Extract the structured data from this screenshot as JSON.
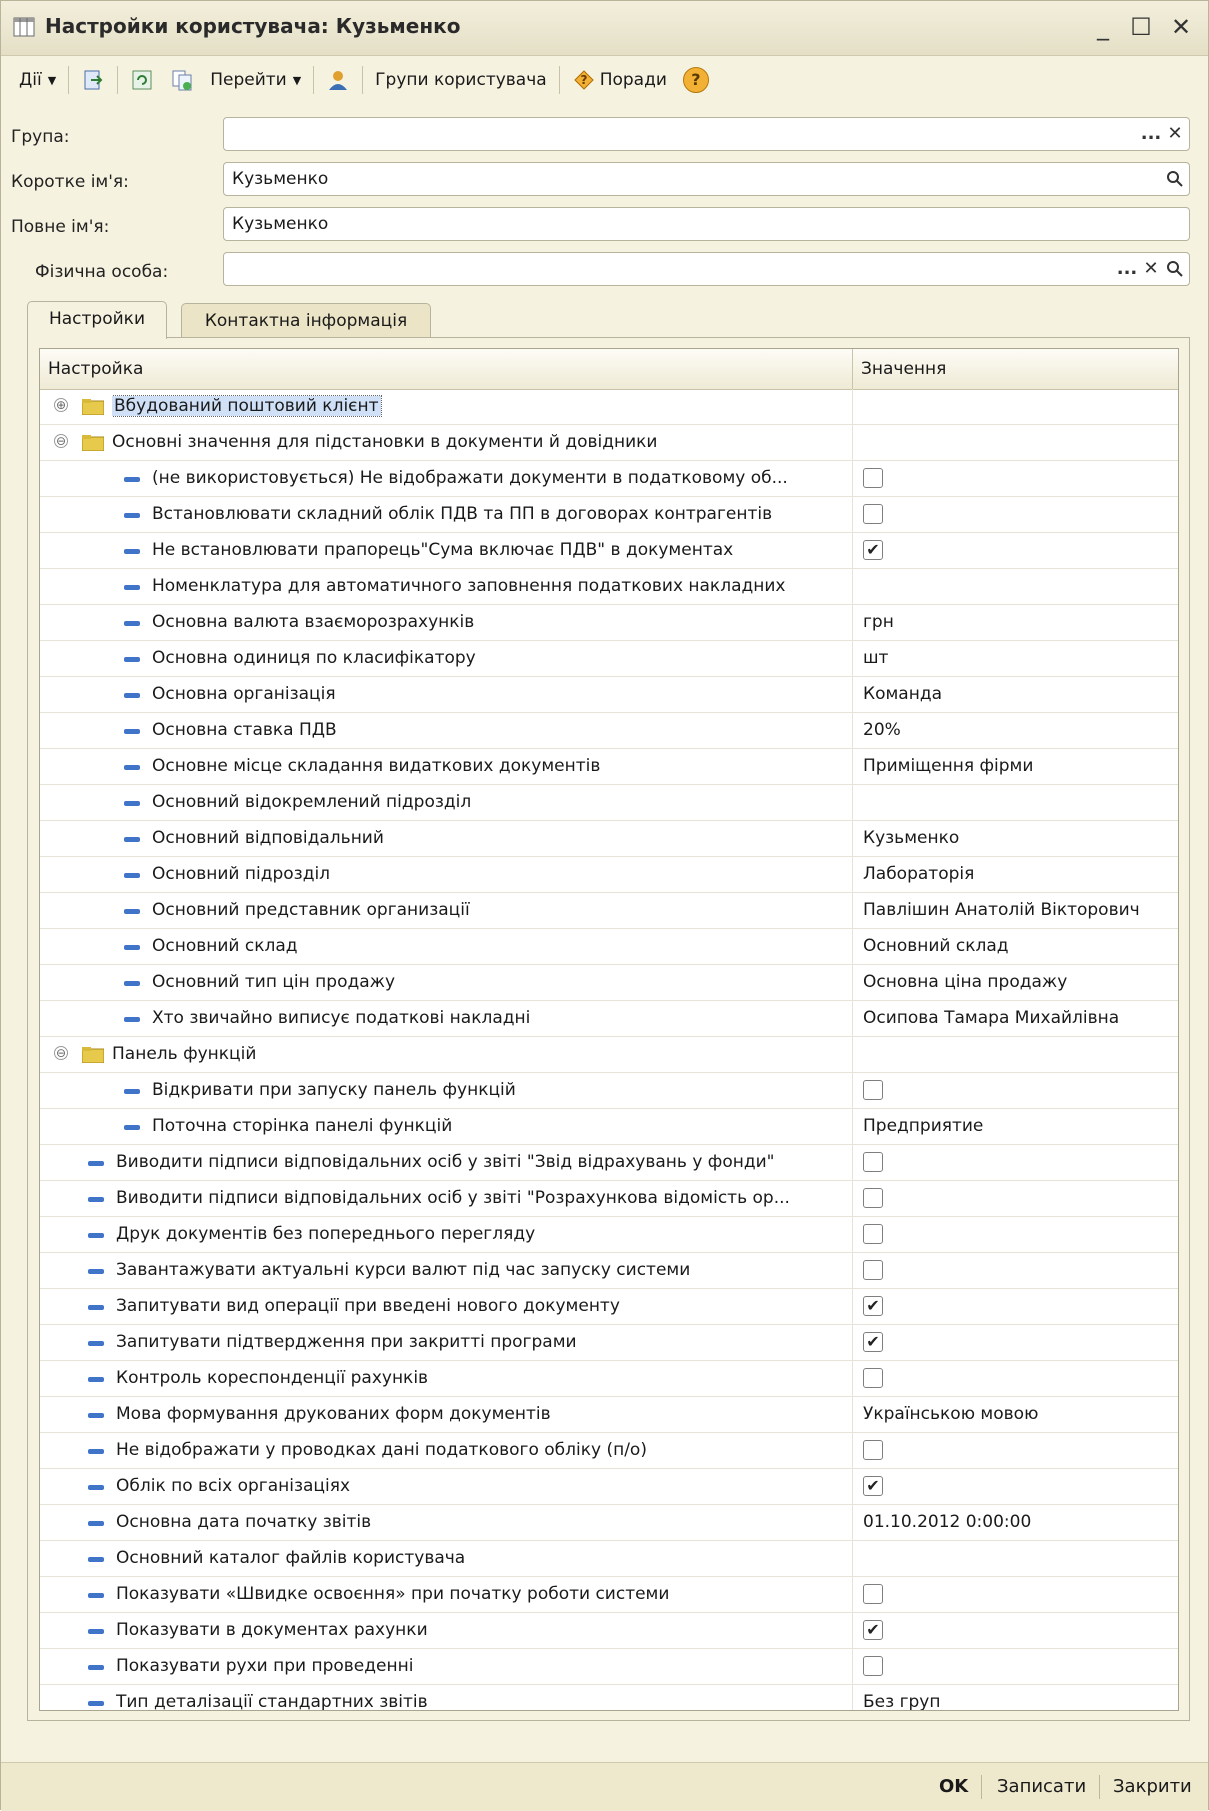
{
  "window": {
    "title": "Настройки користувача: Кузьменко",
    "minimize": "_",
    "maximize": "☐",
    "close": "✕"
  },
  "toolbar": {
    "actions_label": "Дії",
    "goto_label": "Перейти",
    "user_groups_label": "Групи користувача",
    "tips_label": "Поради",
    "help_icon_glyph": "?"
  },
  "form": {
    "group_label": "Група:",
    "group_value": "",
    "short_name_label": "Коротке ім'я:",
    "short_name_value": "Кузьменко",
    "full_name_label": "Повне ім'я:",
    "full_name_value": "Кузьменко",
    "person_label": "Фізична особа:",
    "person_value": "",
    "ellipsis": "...",
    "clear": "✕"
  },
  "tabs": [
    {
      "label": "Настройки",
      "active": true
    },
    {
      "label": "Контактна інформація",
      "active": false
    }
  ],
  "grid": {
    "col_setting": "Настройка",
    "col_value": "Значення",
    "rows": [
      {
        "level": 0,
        "type": "group",
        "expander": "⊕",
        "name": "Вбудований поштовий клієнт",
        "value": "",
        "selected": true
      },
      {
        "level": 0,
        "type": "group",
        "expander": "⊖",
        "name": "Основні значення для підстановки в документи й довідники",
        "value": ""
      },
      {
        "level": 1,
        "type": "item",
        "name": "(не використовується) Не відображати документи в податковому об...",
        "check": false
      },
      {
        "level": 1,
        "type": "item",
        "name": "Встановлювати складний облік ПДВ та ПП в договорах контрагентів",
        "check": false
      },
      {
        "level": 1,
        "type": "item",
        "name": "Не встановлювати прапорець\"Сума включає ПДВ\" в документах",
        "check": true
      },
      {
        "level": 1,
        "type": "item",
        "name": "Номенклатура для автоматичного заповнення податкових накладних",
        "value": ""
      },
      {
        "level": 1,
        "type": "item",
        "name": "Основна валюта взаєморозрахунків",
        "value": "грн"
      },
      {
        "level": 1,
        "type": "item",
        "name": "Основна одиниця по класифікатору",
        "value": "шт"
      },
      {
        "level": 1,
        "type": "item",
        "name": "Основна організація",
        "value": "Команда"
      },
      {
        "level": 1,
        "type": "item",
        "name": "Основна ставка ПДВ",
        "value": "20%"
      },
      {
        "level": 1,
        "type": "item",
        "name": "Основне місце складання видаткових документів",
        "value": "Приміщення фірми"
      },
      {
        "level": 1,
        "type": "item",
        "name": "Основний відокремлений підрозділ",
        "value": ""
      },
      {
        "level": 1,
        "type": "item",
        "name": "Основний відповідальний",
        "value": "Кузьменко"
      },
      {
        "level": 1,
        "type": "item",
        "name": "Основний підрозділ",
        "value": "Лабораторія"
      },
      {
        "level": 1,
        "type": "item",
        "name": "Основний представник организації",
        "value": "Павлішин Анатолій Вікторович"
      },
      {
        "level": 1,
        "type": "item",
        "name": "Основний склад",
        "value": "Основний склад"
      },
      {
        "level": 1,
        "type": "item",
        "name": "Основний тип цін продажу",
        "value": "Основна ціна продажу"
      },
      {
        "level": 1,
        "type": "item",
        "name": "Хто звичайно виписує податкові накладні",
        "value": "Осипова Тамара Михайлівна"
      },
      {
        "level": 0,
        "type": "group",
        "expander": "⊖",
        "name": "Панель функцій",
        "value": ""
      },
      {
        "level": 1,
        "type": "item",
        "name": "Відкривати при запуску панель функцій",
        "check": false
      },
      {
        "level": 1,
        "type": "item",
        "name": "Поточна сторінка панелі функцій",
        "value": "Предприятие"
      },
      {
        "level": 0,
        "type": "item",
        "name": "Виводити підписи відповідальних осіб у звіті \"Звід відрахувань у фонди\"",
        "check": false
      },
      {
        "level": 0,
        "type": "item",
        "name": "Виводити підписи відповідальних осіб у звіті \"Розрахункова відомість ор...",
        "check": false
      },
      {
        "level": 0,
        "type": "item",
        "name": "Друк документів без попереднього перегляду",
        "check": false
      },
      {
        "level": 0,
        "type": "item",
        "name": "Завантажувати актуальні курси валют під час запуску системи",
        "check": false
      },
      {
        "level": 0,
        "type": "item",
        "name": "Запитувати вид операції при введені нового документу",
        "check": true
      },
      {
        "level": 0,
        "type": "item",
        "name": "Запитувати підтвердження при закритті програми",
        "check": true
      },
      {
        "level": 0,
        "type": "item",
        "name": "Контроль кореспонденції рахунків",
        "check": false
      },
      {
        "level": 0,
        "type": "item",
        "name": "Мова формування друкованих форм документів",
        "value": "Українською мовою"
      },
      {
        "level": 0,
        "type": "item",
        "name": "Не відображати у проводках дані податкового обліку (п/о)",
        "check": false
      },
      {
        "level": 0,
        "type": "item",
        "name": "Облік по всіх організаціях",
        "check": true
      },
      {
        "level": 0,
        "type": "item",
        "name": "Основна дата початку звітів",
        "value": "01.10.2012 0:00:00"
      },
      {
        "level": 0,
        "type": "item",
        "name": "Основний каталог файлів користувача",
        "value": ""
      },
      {
        "level": 0,
        "type": "item",
        "name": "Показувати «Швидке освоєння» при початку роботи системи",
        "check": false
      },
      {
        "level": 0,
        "type": "item",
        "name": "Показувати в документах рахунки",
        "check": true
      },
      {
        "level": 0,
        "type": "item",
        "name": "Показувати рухи при проведенні",
        "check": false
      },
      {
        "level": 0,
        "type": "item",
        "name": "Тип деталізації стандартних звітів",
        "value": "Без груп"
      }
    ]
  },
  "footer": {
    "ok_label": "OK",
    "save_label": "Записати",
    "close_label": "Закрити"
  },
  "colors": {
    "window_bg": "#f6f2e0",
    "item_dash": "#3f74c9",
    "selection": "#cfe0f7"
  }
}
